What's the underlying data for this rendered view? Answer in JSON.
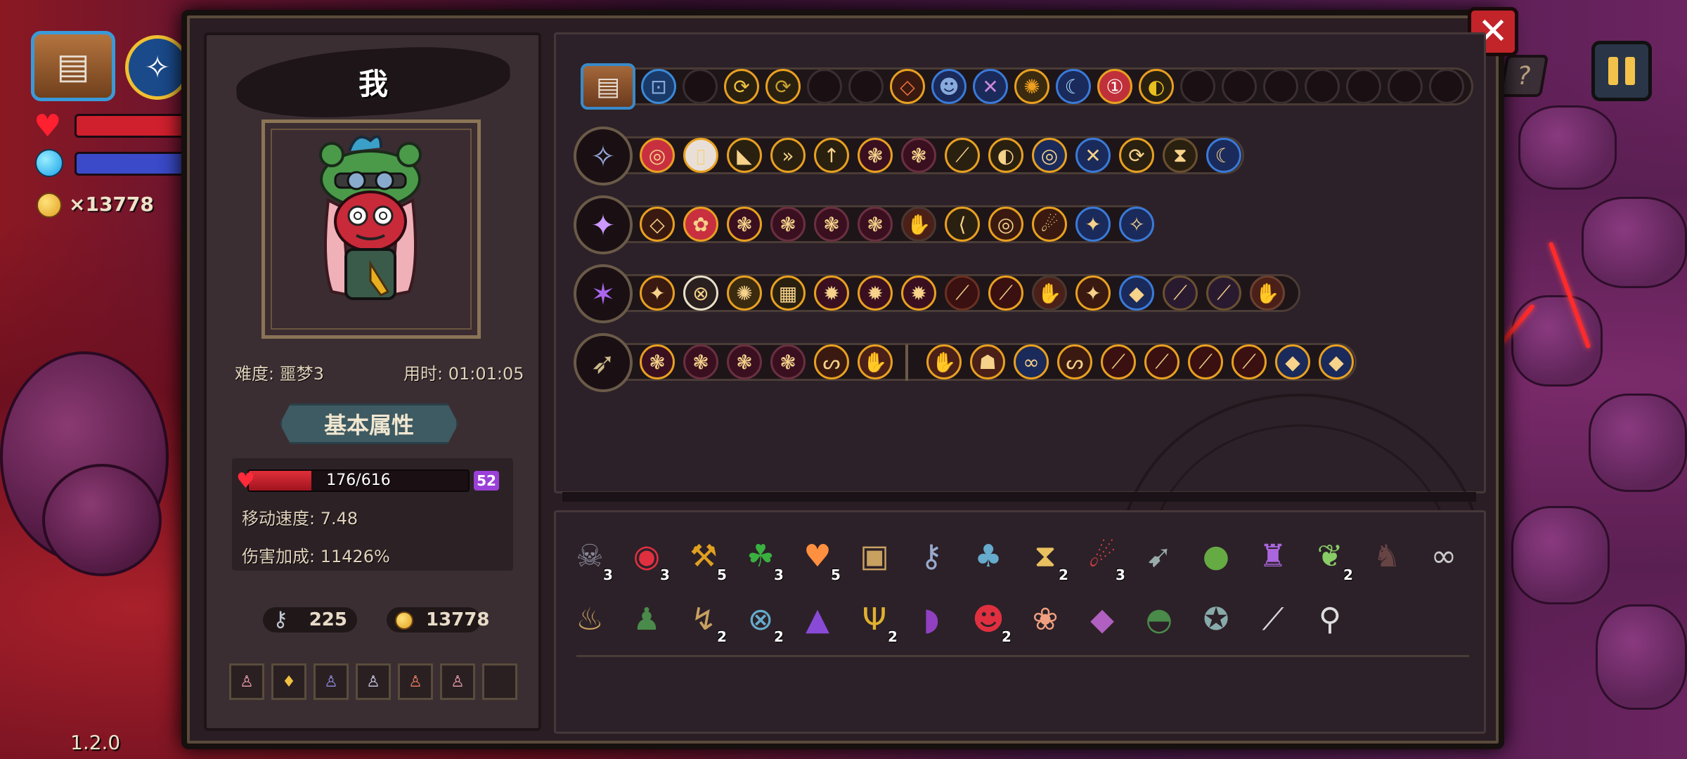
{
  "hud": {
    "gold": "×13778",
    "version": "1.2.0",
    "hp_fraction": 0.75,
    "mp_fraction": 0.75
  },
  "panel": {
    "close_label": "✕",
    "help_label": "?"
  },
  "player": {
    "name": "我",
    "difficulty": "难度: 噩梦3",
    "time": "用时: 01:01:05",
    "section_label": "基本属性",
    "hp_text": "176/616",
    "hp_fraction": 0.2857,
    "level": "52",
    "move_speed": "移动速度: 7.48",
    "damage_bonus": "伤害加成: 11426%",
    "keys": "225",
    "coins": "13778"
  },
  "colors": {
    "gold_border": "#e8a020",
    "blue_border": "#3a7ad8",
    "hp_red": "#d0202e",
    "mana_blue": "#3a4ac8"
  },
  "weapons": [
    {
      "icon": "staff-icon",
      "glyph": "✧"
    },
    {
      "icon": "crystal-staff-icon",
      "glyph": "✦"
    },
    {
      "icon": "purple-scepter-icon",
      "glyph": "✶"
    },
    {
      "icon": "spear-icon",
      "glyph": "➶"
    }
  ],
  "passives": {
    "row1": [
      {
        "icon": "skull-mask-icon",
        "glyph": "☠",
        "count": "3"
      },
      {
        "icon": "red-eye-icon",
        "glyph": "◉",
        "count": "3"
      },
      {
        "icon": "pickaxe-icon",
        "glyph": "⚒",
        "count": "5"
      },
      {
        "icon": "clover-icon",
        "glyph": "☘",
        "count": "3"
      },
      {
        "icon": "heart-icon",
        "glyph": "♥",
        "count": "5"
      },
      {
        "icon": "chest-icon",
        "glyph": "▣",
        "count": ""
      },
      {
        "icon": "key-icon",
        "glyph": "⚷",
        "count": ""
      },
      {
        "icon": "bell-icon",
        "glyph": "♣",
        "count": ""
      },
      {
        "icon": "hourglass-icon",
        "glyph": "⧗",
        "count": "2"
      },
      {
        "icon": "red-dragon-icon",
        "glyph": "☄",
        "count": "3"
      },
      {
        "icon": "feather-icon",
        "glyph": "➹",
        "count": ""
      },
      {
        "icon": "green-orb-icon",
        "glyph": "●",
        "count": ""
      },
      {
        "icon": "cape-icon",
        "glyph": "♜",
        "count": ""
      },
      {
        "icon": "leaf-icon",
        "glyph": "❦",
        "count": "2"
      },
      {
        "icon": "beast-icon",
        "glyph": "♞",
        "count": ""
      },
      {
        "icon": "goggles-icon",
        "glyph": "∞",
        "count": ""
      }
    ],
    "row2": [
      {
        "icon": "lantern-icon",
        "glyph": "♨",
        "count": ""
      },
      {
        "icon": "vest-icon",
        "glyph": "♟",
        "count": ""
      },
      {
        "icon": "boomerang-icon",
        "glyph": "↯",
        "count": "2"
      },
      {
        "icon": "chain-icon",
        "glyph": "⊗",
        "count": "2"
      },
      {
        "icon": "wizard-hat-icon",
        "glyph": "▲",
        "count": ""
      },
      {
        "icon": "antler-icon",
        "glyph": "Ψ",
        "count": "2"
      },
      {
        "icon": "rainbow-cloak-icon",
        "glyph": "◗",
        "count": ""
      },
      {
        "icon": "demon-mask-icon",
        "glyph": "☻",
        "count": "2"
      },
      {
        "icon": "brain-icon",
        "glyph": "❀",
        "count": ""
      },
      {
        "icon": "spellbook-icon",
        "glyph": "◆",
        "count": ""
      },
      {
        "icon": "green-helmet-icon",
        "glyph": "◓",
        "count": ""
      },
      {
        "icon": "compass-icon",
        "glyph": "✪",
        "count": ""
      },
      {
        "icon": "claw-icon",
        "glyph": "⟋",
        "count": ""
      },
      {
        "icon": "magnifier-key-icon",
        "glyph": "⚲",
        "count": ""
      }
    ]
  }
}
